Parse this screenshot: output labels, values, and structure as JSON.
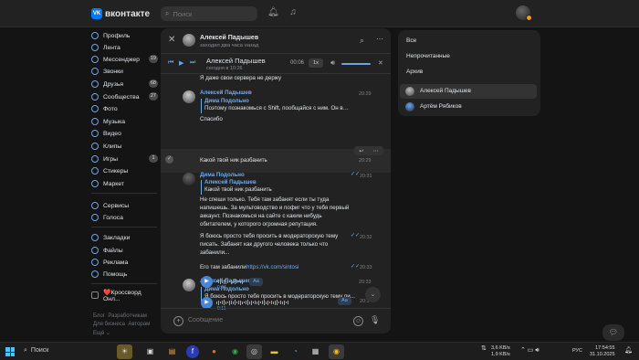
{
  "topbar": {
    "logo_badge": "VK",
    "logo_text": "вконтакте",
    "search_placeholder": "Поиск"
  },
  "sidebar": {
    "items": [
      {
        "label": "Профиль",
        "icon": "user-icon"
      },
      {
        "label": "Лента",
        "icon": "feed-icon"
      },
      {
        "label": "Мессенджер",
        "icon": "message-icon",
        "count": "19"
      },
      {
        "label": "Звонки",
        "icon": "phone-icon"
      },
      {
        "label": "Друзья",
        "icon": "friends-icon",
        "count": "68"
      },
      {
        "label": "Сообщества",
        "icon": "groups-icon",
        "count": "27"
      },
      {
        "label": "Фото",
        "icon": "photo-icon"
      },
      {
        "label": "Музыка",
        "icon": "music-icon"
      },
      {
        "label": "Видео",
        "icon": "video-icon"
      },
      {
        "label": "Клипы",
        "icon": "clips-icon"
      },
      {
        "label": "Игры",
        "icon": "games-icon",
        "count": "1"
      },
      {
        "label": "Стикеры",
        "icon": "sticker-icon"
      },
      {
        "label": "Маркет",
        "icon": "market-icon"
      },
      {
        "label": "Сервисы",
        "icon": "services-icon"
      },
      {
        "label": "Голоса",
        "icon": "votes-icon"
      },
      {
        "label": "Закладки",
        "icon": "bookmark-icon"
      },
      {
        "label": "Файлы",
        "icon": "files-icon"
      },
      {
        "label": "Реклама",
        "icon": "ads-icon"
      },
      {
        "label": "Помощь",
        "icon": "help-icon"
      },
      {
        "label": "❤️Кроссворд Онл...",
        "icon": "game-app-icon"
      }
    ],
    "footer": [
      "Блог",
      "Разработчикам",
      "Для бизнеса",
      "Авторам",
      "Ещё"
    ]
  },
  "chat": {
    "header_name": "Алексей Падышев",
    "header_sub": "заходил два часа назад",
    "player_title": "Алексей Падышев",
    "player_sub": "сегодня в 10:26",
    "player_time": "00:06",
    "player_speed": "1x",
    "compose_placeholder": "Сообщение",
    "messages": {
      "top_text": "Я даже свои сервера не держу",
      "m1_name": "Алексей Падышев",
      "m1_time": "20:29",
      "m1_quote_name": "Дима Подольно",
      "m1_quote_text": "Поэтому познакомься с Shift, пообщайся с ним. Он врод...",
      "m1_text": "Спасибо",
      "m2_text": "Какой твой ник разбанить",
      "m2_time": "20:29",
      "m3_name": "Дима Подольно",
      "m3_time": "20:31",
      "m3_quote_name": "Алексей Падышев",
      "m3_quote_text": "Какой твой ник разбанить",
      "m3_lines": [
        "Не спеши только. Тебя там забанят если ты туда",
        "напишешь. За мультоводство и пофиг что у тебя первый",
        "аккаунт. Познакомься на сайте с каким нибудь",
        "обитателем, у которого огромная репутация."
      ],
      "m4_lines": [
        "Я боюсь просто тебя просить в модераторскую тему",
        "писать. Забанят как другого человека только что",
        "забанили..."
      ],
      "m4_time": "20:32",
      "m5_text": "Его там забанили",
      "m5_link": "https://vk.com/sintosi",
      "m5_time": "20:33",
      "m6_name": "Алексей Падышев",
      "m6_time": "20:33",
      "m6_quote_name": "Дима Подольно",
      "m6_quote_text": "Я боюсь просто тебя просить в модераторскую тему пи...",
      "voice1_dur": "0:04",
      "voice2_dur": "0:11",
      "voice2_time": "20:34",
      "aa": "Aa"
    }
  },
  "folders": {
    "items": [
      "Все",
      "Непрочитанные",
      "Архив",
      "Алексей Падышев",
      "Артём Рябиков"
    ]
  },
  "taskbar": {
    "search_label": "Поиск",
    "net_up": "3,6 KB/s",
    "net_down": "1,9 KB/s",
    "lang": "РУС",
    "time": "17:54:55",
    "date": "31.10.2025"
  },
  "colors": {
    "accent": "#71aaeb",
    "brand": "#0077ff",
    "bg": "#141414",
    "panel": "#222222"
  }
}
